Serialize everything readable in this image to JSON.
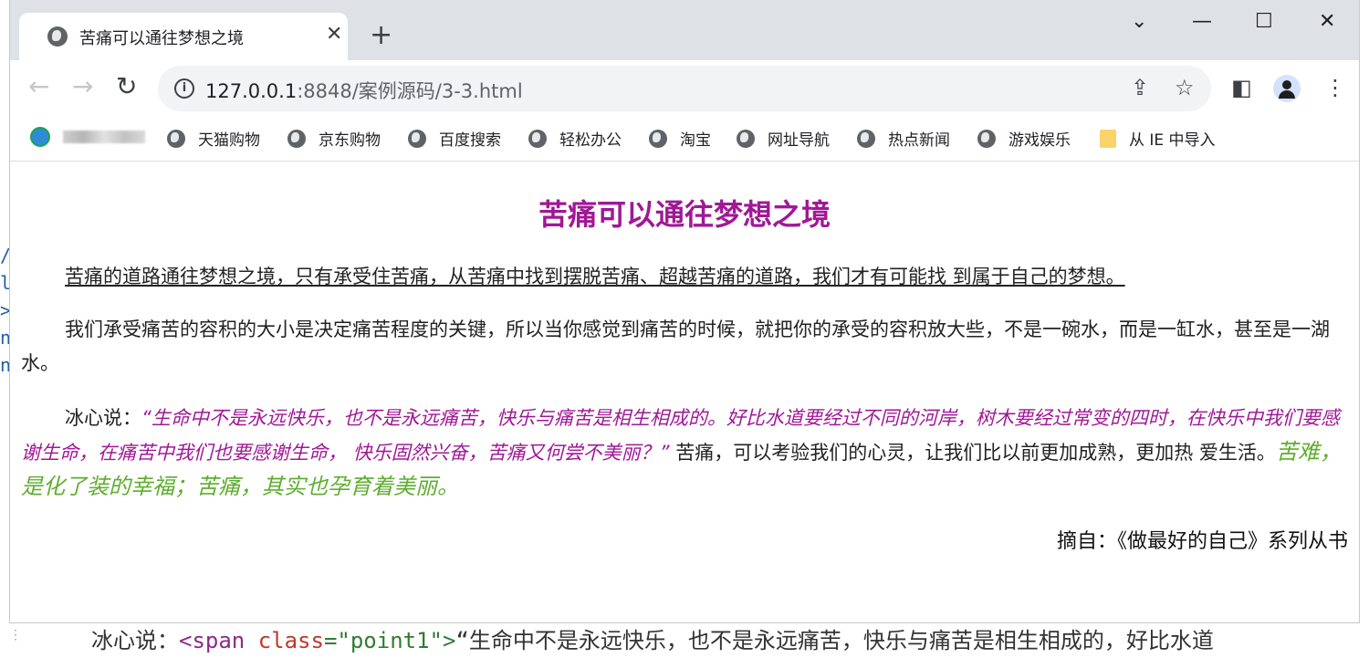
{
  "browser": {
    "tab_title": "苦痛可以通往梦想之境",
    "url_host": "127.0.0.1",
    "url_path": ":8848/案例源码/3-3.html"
  },
  "bookmarks": [
    {
      "label": "天猫购物"
    },
    {
      "label": "京东购物"
    },
    {
      "label": "百度搜索"
    },
    {
      "label": "轻松办公"
    },
    {
      "label": "淘宝"
    },
    {
      "label": "网址导航"
    },
    {
      "label": "热点新闻"
    },
    {
      "label": "游戏娱乐"
    },
    {
      "label": "从 IE 中导入"
    }
  ],
  "article": {
    "title": "苦痛可以通往梦想之境",
    "p1": "苦痛的道路通往梦想之境，只有承受住苦痛，从苦痛中找到摆脱苦痛、超越苦痛的道路，我们才有可能找 到属于自己的梦想。",
    "p2": "我们承受痛苦的容积的大小是决定痛苦程度的关键，所以当你感觉到痛苦的时候，就把你的承受的容积放大些，不是一碗水，而是一缸水，甚至是一湖水。",
    "p3_prefix": "冰心说：",
    "p3_quote": "“生命中不是永远快乐，也不是永远痛苦，快乐与痛苦是相生相成的。好比水道要经过不同的河岸，树木要经过常变的四时，在快乐中我们要感谢生命，在痛苦中我们也要感谢生命， 快乐固然兴奋，苦痛又何尝不美丽？”",
    "p3_middle": " 苦痛，可以考验我们的心灵，让我们比以前更加成熟，更加热 爱生活。",
    "p3_green": "苦难，是化了装的幸福；苦痛，其实也孕育着美丽。",
    "signature": "摘自：《做最好的自己》系列从书"
  },
  "background_editor": {
    "bottom_text_prefix": "冰心说：",
    "bottom_tag": "<span ",
    "bottom_attr": "class",
    "bottom_val": "=\"point1\">",
    "bottom_rest": "“生命中不是永远快乐，也不是永远痛苦，快乐与痛苦是相生相成的，好比水道"
  }
}
